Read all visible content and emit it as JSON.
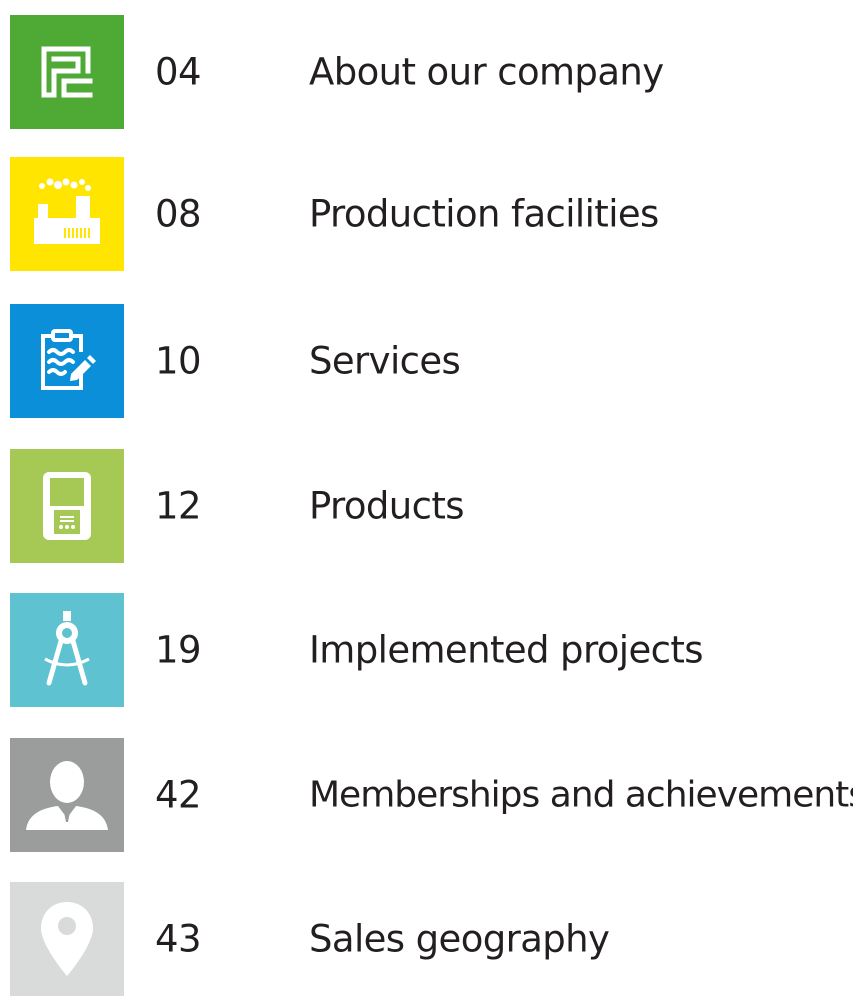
{
  "toc": {
    "items": [
      {
        "page": "04",
        "title": "About our company",
        "icon": "company-logo-icon",
        "color": "#4eaa35"
      },
      {
        "page": "08",
        "title": "Production facilities",
        "icon": "factory-icon",
        "color": "#ffe500"
      },
      {
        "page": "10",
        "title": "Services",
        "icon": "clipboard-icon",
        "color": "#0a8fd8"
      },
      {
        "page": "12",
        "title": "Products",
        "icon": "device-icon",
        "color": "#a6c855"
      },
      {
        "page": "19",
        "title": "Implemented projects",
        "icon": "compass-icon",
        "color": "#5fc2d0"
      },
      {
        "page": "42",
        "title": "Memberships and achievements",
        "icon": "person-icon",
        "color": "#9b9c9c"
      },
      {
        "page": "43",
        "title": "Sales geography",
        "icon": "location-pin-icon",
        "color": "#d9dada"
      }
    ]
  }
}
